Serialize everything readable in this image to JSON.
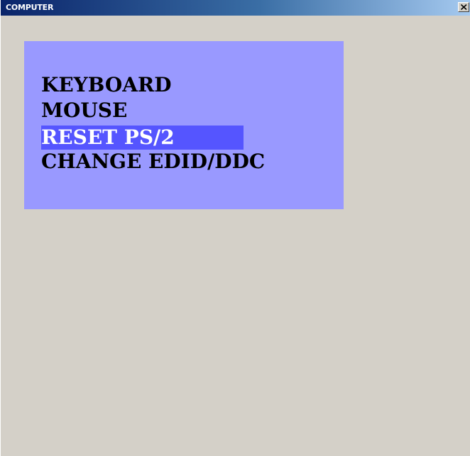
{
  "window": {
    "title": "COMPUTER",
    "close_glyph": "close-icon"
  },
  "menu": {
    "items": [
      {
        "label": "KEYBOARD",
        "selected": false
      },
      {
        "label": "MOUSE",
        "selected": false
      },
      {
        "label": "RESET PS/2",
        "selected": true
      },
      {
        "label": "CHANGE EDID/DDC",
        "selected": false
      }
    ]
  },
  "colors": {
    "panel": "#9999ff",
    "highlight": "#5555ff",
    "window_bg": "#d4d0c8",
    "title_start": "#0a246a",
    "title_end": "#a6caf0"
  }
}
